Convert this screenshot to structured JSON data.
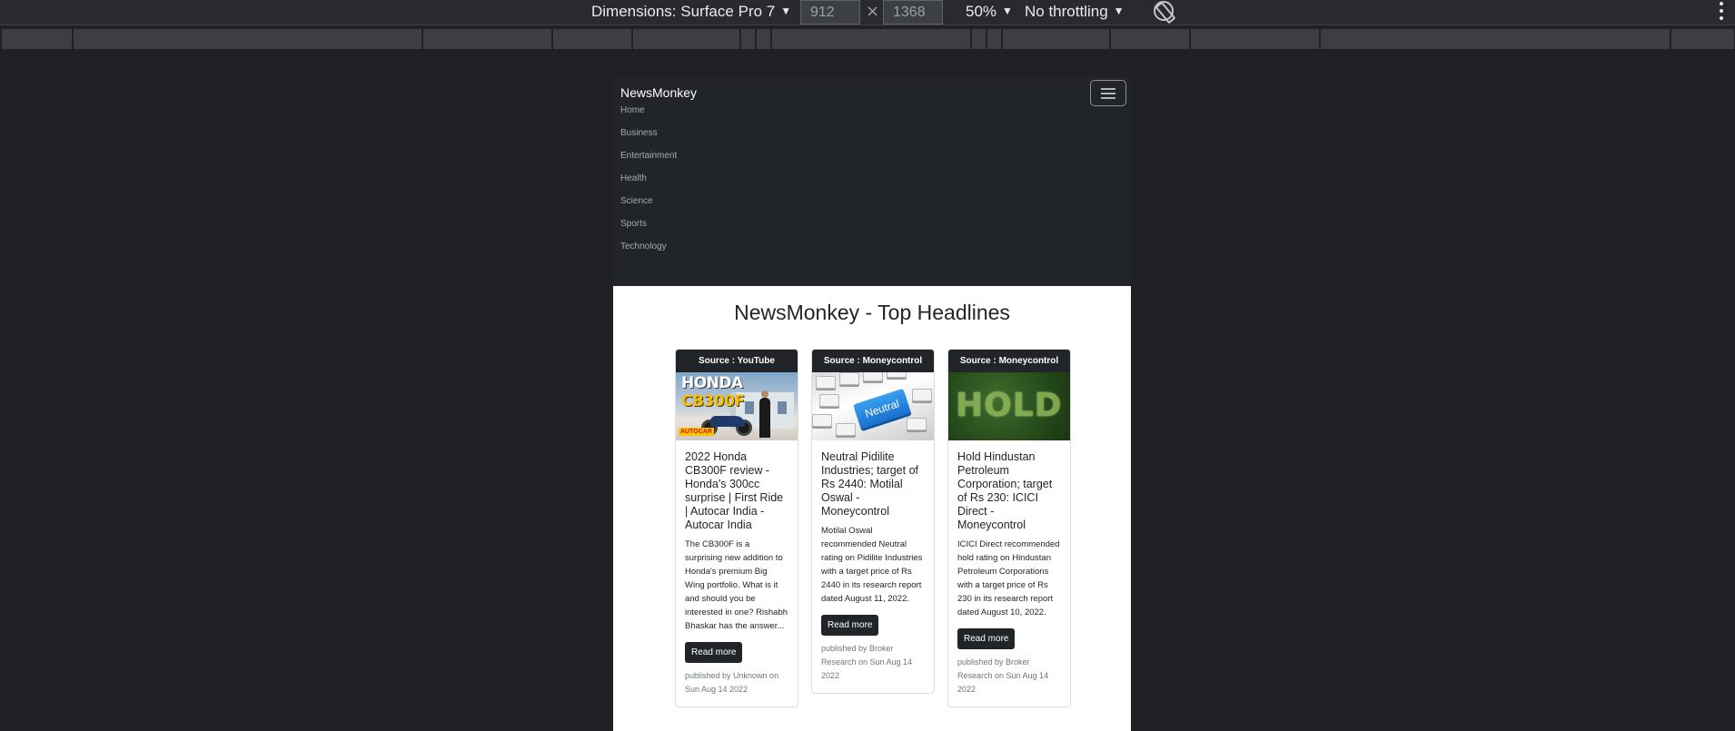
{
  "devtools": {
    "device_label": "Dimensions: Surface Pro 7",
    "width_value": "912",
    "height_value": "1368",
    "times": "×",
    "zoom": "50%",
    "throttling": "No throttling"
  },
  "navbar": {
    "brand": "NewsMonkey",
    "items": [
      "Home",
      "Business",
      "Entertainment",
      "Health",
      "Science",
      "Sports",
      "Technology"
    ]
  },
  "main": {
    "title": "NewsMonkey - Top Headlines",
    "cards": [
      {
        "source": "Source : YouTube",
        "title": "2022 Honda CB300F review - Honda's 300cc surprise | First Ride | Autocar India - Autocar India",
        "description": "The CB300F is a surprising new addition to Honda's premium Big Wing portfolio. What is it and should you be interested in one? Rishabh Bhaskar has the answer...",
        "button": "Read more",
        "meta": "published by Unknown on Sun Aug 14 2022",
        "thumb_text_white": "HONDA ",
        "thumb_text_yellow": "CB300F",
        "thumb_logo": "AUTOCAR"
      },
      {
        "source": "Source : Moneycontrol",
        "title": "Neutral Pidilite Industries; target of Rs 2440: Motilal Oswal - Moneycontrol",
        "description": "Motilal Oswal recommended Neutral rating on Pidilite Industries with a target price of Rs 2440 in its research report dated August 11, 2022.",
        "button": "Read more",
        "meta": "published by Broker Research on Sun Aug 14 2022",
        "thumb_key_text": "Neutral"
      },
      {
        "source": "Source : Moneycontrol",
        "title": "Hold Hindustan Petroleum Corporation; target of Rs 230: ICICI Direct - Moneycontrol",
        "description": "ICICI Direct recommended hold rating on Hindustan Petroleum Corporations with a target price of Rs 230 in its research report dated August 10, 2022.",
        "button": "Read more",
        "meta": "published by Broker Research on Sun Aug 14 2022",
        "thumb_text": "HOLD"
      }
    ]
  }
}
